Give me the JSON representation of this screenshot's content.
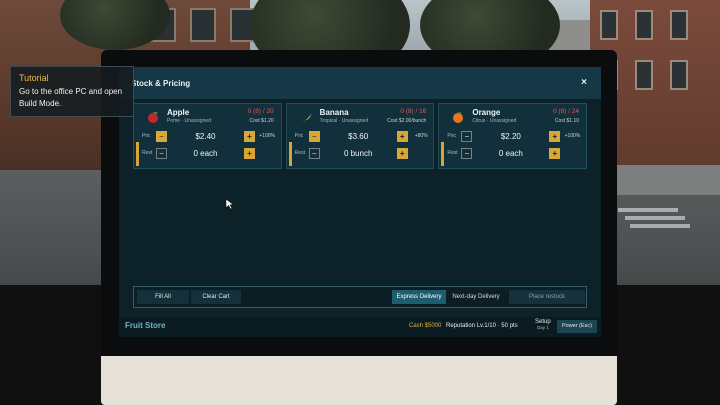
{
  "tutorial": {
    "title": "Tutorial",
    "body": "Go to the office PC and open Build Mode."
  },
  "window": {
    "title": "Stock & Pricing",
    "close": "×"
  },
  "products": [
    {
      "name": "Apple",
      "category": "Pome · Unassigned",
      "stock": "0 (8) / 20",
      "cost": "Cost $1.20",
      "price_label": "Pric",
      "price": "$2.40",
      "markup": "+100%",
      "restock_label": "Rest",
      "restock": "0 each",
      "icon": "apple-icon",
      "price_minus_active": true
    },
    {
      "name": "Banana",
      "category": "Tropical · Unassigned",
      "stock": "0 (8) / 16",
      "cost": "Cost $2.00/bunch",
      "price_label": "Pric",
      "price": "$3.60",
      "markup": "+80%",
      "restock_label": "Rest",
      "restock": "0 bunch",
      "icon": "banana-icon",
      "price_minus_active": true
    },
    {
      "name": "Orange",
      "category": "Citrus · Unassigned",
      "stock": "0 (8) / 24",
      "cost": "Cost $1.10",
      "price_label": "Pric",
      "price": "$2.20",
      "markup": "+100%",
      "restock_label": "Rest",
      "restock": "0 each",
      "icon": "orange-icon",
      "price_minus_active": false
    }
  ],
  "controls": {
    "minus": "−",
    "plus": "+"
  },
  "footer": {
    "fill_all": "Fill All",
    "clear_cart": "Clear Cart",
    "express": "Express Delivery",
    "next_day": "Next-day Delivery",
    "place_restock": "Place restock"
  },
  "status": {
    "store_name": "Fruit Store",
    "cash": "Cash $5000",
    "reputation": "Reputation Lv.1/10 · 50 pts",
    "phase": "Setup",
    "day": "Day 1",
    "power": "Power (Esc)"
  },
  "colors": {
    "accent_gold": "#d7a837",
    "stock_red": "#e0584c",
    "store_blue": "#6fb3cb"
  }
}
